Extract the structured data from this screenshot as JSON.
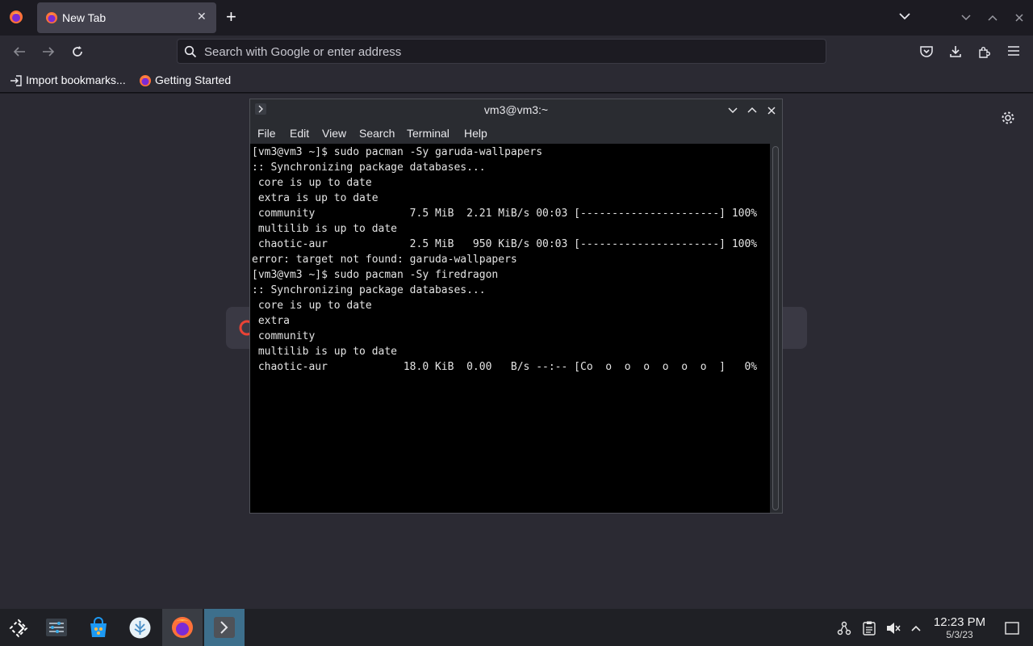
{
  "browser": {
    "tab_title": "New Tab",
    "url_placeholder": "Search with Google or enter address",
    "bookmarks": [
      "Import bookmarks...",
      "Getting Started"
    ]
  },
  "terminal": {
    "title": "vm3@vm3:~",
    "menu": [
      "File",
      "Edit",
      "View",
      "Search",
      "Terminal",
      "Help"
    ],
    "lines": [
      "[vm3@vm3 ~]$ sudo pacman -Sy garuda-wallpapers",
      ":: Synchronizing package databases...",
      " core is up to date",
      " extra is up to date",
      " community               7.5 MiB  2.21 MiB/s 00:03 [----------------------] 100%",
      " multilib is up to date",
      " chaotic-aur             2.5 MiB   950 KiB/s 00:03 [----------------------] 100%",
      "error: target not found: garuda-wallpapers",
      "[vm3@vm3 ~]$ sudo pacman -Sy firedragon",
      ":: Synchronizing package databases...",
      " core is up to date",
      " extra",
      " community",
      " multilib is up to date",
      " chaotic-aur            18.0 KiB  0.00   B/s --:-- [Co  o  o  o  o  o  o  ]   0%"
    ]
  },
  "taskbar": {
    "time": "12:23 PM",
    "date": "5/3/23"
  }
}
